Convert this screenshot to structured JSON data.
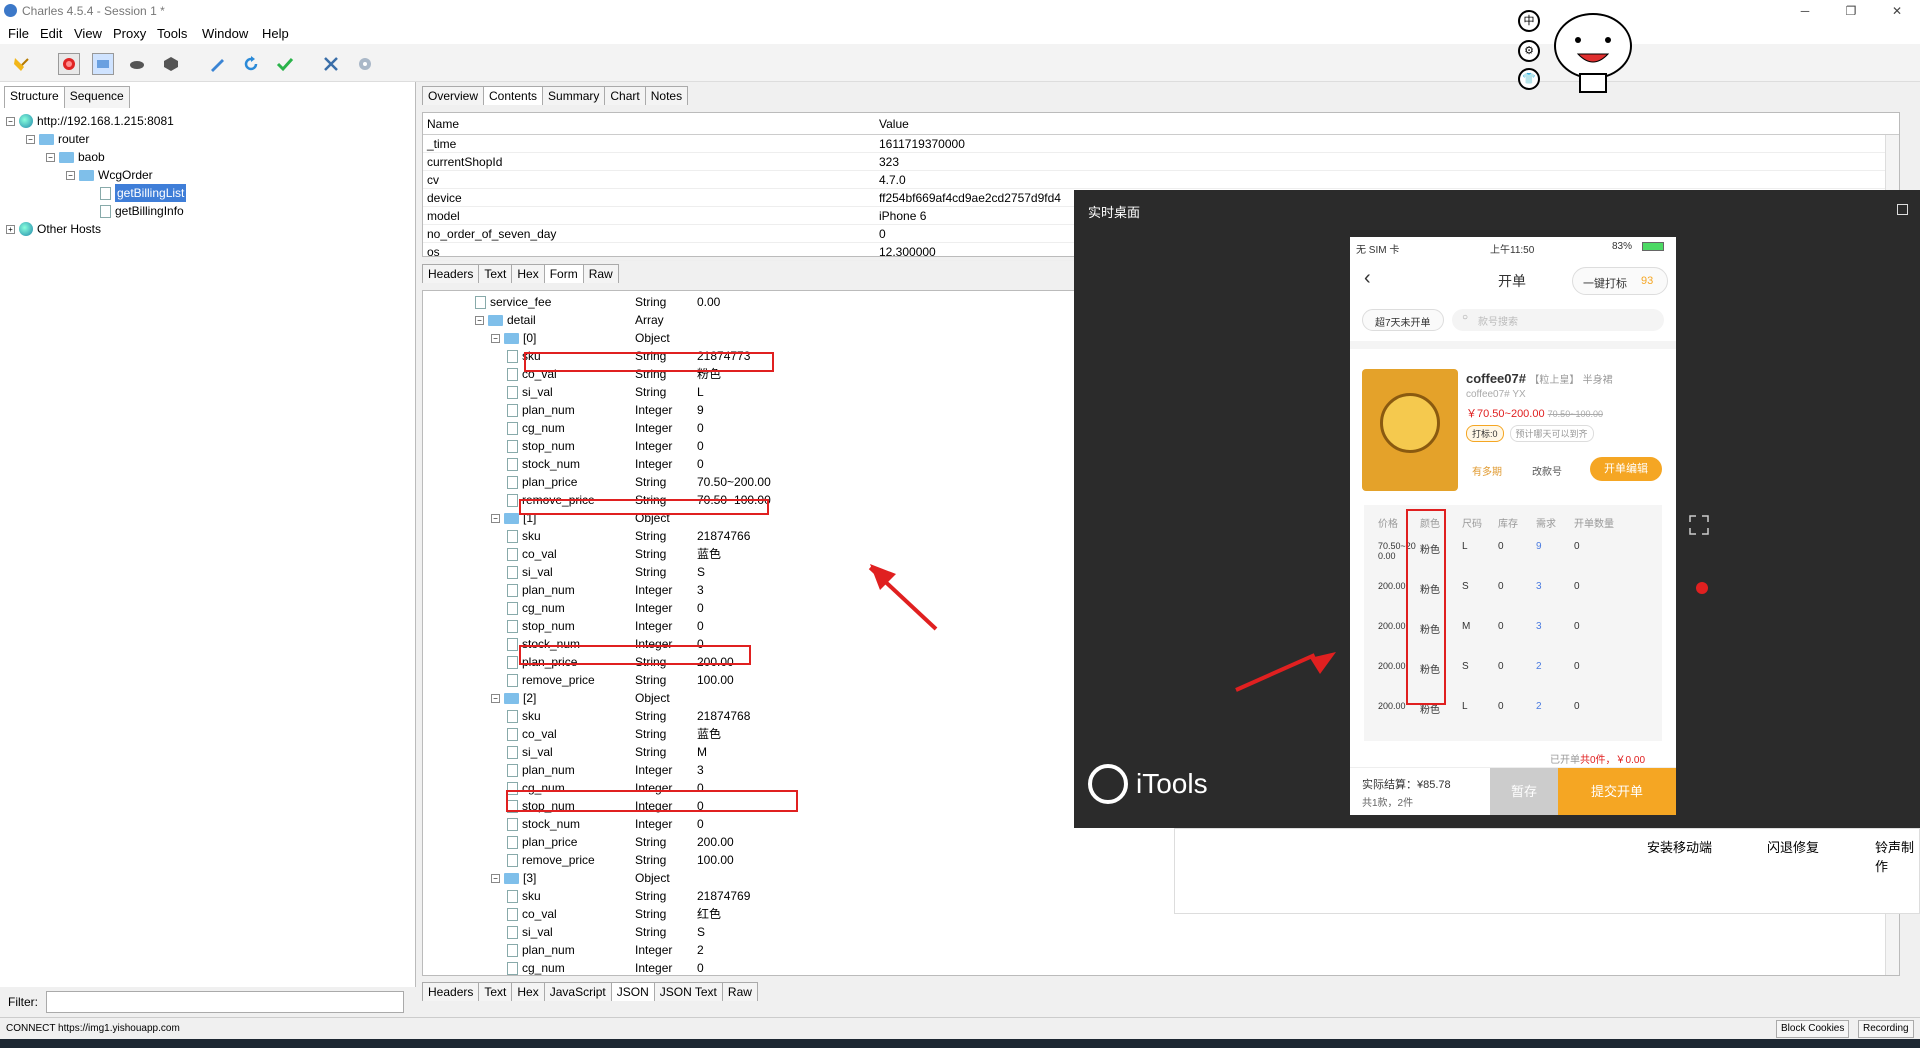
{
  "window": {
    "title": "Charles 4.5.4 - Session 1 *"
  },
  "menu": [
    "File",
    "Edit",
    "View",
    "Proxy",
    "Tools",
    "Window",
    "Help"
  ],
  "left": {
    "tabs": [
      "Structure",
      "Sequence"
    ],
    "tree": {
      "root": "http://192.168.1.215:8081",
      "router": "router",
      "baob": "baob",
      "wcg": "WcgOrder",
      "item1": "getBillingList",
      "item2": "getBillingInfo",
      "other": "Other Hosts"
    },
    "filter_label": "Filter:"
  },
  "right": {
    "tabs": [
      "Overview",
      "Contents",
      "Summary",
      "Chart",
      "Notes"
    ],
    "table": {
      "headers": [
        "Name",
        "Value"
      ],
      "rows": [
        {
          "name": "_time",
          "value": "1611719370000"
        },
        {
          "name": "currentShopId",
          "value": "323"
        },
        {
          "name": "cv",
          "value": "4.7.0"
        },
        {
          "name": "device",
          "value": "ff254bf669af4cd9ae2cd2757d9fd4"
        },
        {
          "name": "model",
          "value": "iPhone 6"
        },
        {
          "name": "no_order_of_seven_day",
          "value": "0"
        },
        {
          "name": "os",
          "value": "12.300000"
        }
      ]
    },
    "subtabs_req": [
      "Headers",
      "Text",
      "Hex",
      "Form",
      "Raw"
    ],
    "subtabs_resp": [
      "Headers",
      "Text",
      "Hex",
      "JavaScript",
      "JSON",
      "JSON Text",
      "Raw"
    ],
    "json_rows": [
      {
        "name": "service_fee",
        "type": "String",
        "value": "0.00",
        "level": 3,
        "leaf": true
      },
      {
        "name": "detail",
        "type": "Array",
        "value": "",
        "level": 3,
        "leaf": false
      },
      {
        "name": "[0]",
        "type": "Object",
        "value": "",
        "level": 4,
        "leaf": false
      },
      {
        "name": "sku",
        "type": "String",
        "value": "21874773",
        "level": 5,
        "leaf": true
      },
      {
        "name": "co_val",
        "type": "String",
        "value": "粉色",
        "level": 5,
        "leaf": true
      },
      {
        "name": "si_val",
        "type": "String",
        "value": "L",
        "level": 5,
        "leaf": true
      },
      {
        "name": "plan_num",
        "type": "Integer",
        "value": "9",
        "level": 5,
        "leaf": true
      },
      {
        "name": "cg_num",
        "type": "Integer",
        "value": "0",
        "level": 5,
        "leaf": true
      },
      {
        "name": "stop_num",
        "type": "Integer",
        "value": "0",
        "level": 5,
        "leaf": true
      },
      {
        "name": "stock_num",
        "type": "Integer",
        "value": "0",
        "level": 5,
        "leaf": true
      },
      {
        "name": "plan_price",
        "type": "String",
        "value": "70.50~200.00",
        "level": 5,
        "leaf": true
      },
      {
        "name": "remove_price",
        "type": "String",
        "value": "70.50~100.00",
        "level": 5,
        "leaf": true
      },
      {
        "name": "[1]",
        "type": "Object",
        "value": "",
        "level": 4,
        "leaf": false
      },
      {
        "name": "sku",
        "type": "String",
        "value": "21874766",
        "level": 5,
        "leaf": true
      },
      {
        "name": "co_val",
        "type": "String",
        "value": "蓝色",
        "level": 5,
        "leaf": true
      },
      {
        "name": "si_val",
        "type": "String",
        "value": "S",
        "level": 5,
        "leaf": true
      },
      {
        "name": "plan_num",
        "type": "Integer",
        "value": "3",
        "level": 5,
        "leaf": true
      },
      {
        "name": "cg_num",
        "type": "Integer",
        "value": "0",
        "level": 5,
        "leaf": true
      },
      {
        "name": "stop_num",
        "type": "Integer",
        "value": "0",
        "level": 5,
        "leaf": true
      },
      {
        "name": "stock_num",
        "type": "Integer",
        "value": "0",
        "level": 5,
        "leaf": true
      },
      {
        "name": "plan_price",
        "type": "String",
        "value": "200.00",
        "level": 5,
        "leaf": true
      },
      {
        "name": "remove_price",
        "type": "String",
        "value": "100.00",
        "level": 5,
        "leaf": true
      },
      {
        "name": "[2]",
        "type": "Object",
        "value": "",
        "level": 4,
        "leaf": false
      },
      {
        "name": "sku",
        "type": "String",
        "value": "21874768",
        "level": 5,
        "leaf": true
      },
      {
        "name": "co_val",
        "type": "String",
        "value": "蓝色",
        "level": 5,
        "leaf": true
      },
      {
        "name": "si_val",
        "type": "String",
        "value": "M",
        "level": 5,
        "leaf": true
      },
      {
        "name": "plan_num",
        "type": "Integer",
        "value": "3",
        "level": 5,
        "leaf": true
      },
      {
        "name": "cg_num",
        "type": "Integer",
        "value": "0",
        "level": 5,
        "leaf": true
      },
      {
        "name": "stop_num",
        "type": "Integer",
        "value": "0",
        "level": 5,
        "leaf": true
      },
      {
        "name": "stock_num",
        "type": "Integer",
        "value": "0",
        "level": 5,
        "leaf": true
      },
      {
        "name": "plan_price",
        "type": "String",
        "value": "200.00",
        "level": 5,
        "leaf": true
      },
      {
        "name": "remove_price",
        "type": "String",
        "value": "100.00",
        "level": 5,
        "leaf": true
      },
      {
        "name": "[3]",
        "type": "Object",
        "value": "",
        "level": 4,
        "leaf": false
      },
      {
        "name": "sku",
        "type": "String",
        "value": "21874769",
        "level": 5,
        "leaf": true
      },
      {
        "name": "co_val",
        "type": "String",
        "value": "红色",
        "level": 5,
        "leaf": true
      },
      {
        "name": "si_val",
        "type": "String",
        "value": "S",
        "level": 5,
        "leaf": true
      },
      {
        "name": "plan_num",
        "type": "Integer",
        "value": "2",
        "level": 5,
        "leaf": true
      },
      {
        "name": "cg_num",
        "type": "Integer",
        "value": "0",
        "level": 5,
        "leaf": true
      }
    ]
  },
  "status": {
    "text": "CONNECT https://img1.yishouapp.com",
    "block_cookies": "Block Cookies",
    "recording": "Recording"
  },
  "overlay": {
    "title": "实时桌面",
    "brand": "iTools"
  },
  "phone": {
    "carrier": "无 SIM 卡",
    "time": "上午11:50",
    "battery": "83%",
    "title": "开单",
    "one_key": "一键打标",
    "one_key_count": "93",
    "filter_chip": "超7天未开单",
    "search_placeholder": "款号搜索",
    "product_name": "coffee07#",
    "product_tag": "【粒上皇】",
    "product_cat": "半身裙",
    "product_sub": "coffee07#  YX",
    "price": "￥70.50~200.00",
    "old_price": "70.50~100.00",
    "mark": "打标:0",
    "tip": "预计哪天可以到齐",
    "opt1": "有多期",
    "opt2": "改款号",
    "edit_btn": "开单编辑",
    "grid_headers": [
      "价格",
      "颜色",
      "尺码",
      "库存",
      "需求",
      "开单数量"
    ],
    "grid_rows": [
      {
        "price": "70.50~200.00",
        "color": "粉色",
        "size": "L",
        "stock": "0",
        "need": "9",
        "qty": "0"
      },
      {
        "price": "200.00",
        "color": "粉色",
        "size": "S",
        "stock": "0",
        "need": "3",
        "qty": "0"
      },
      {
        "price": "200.00",
        "color": "粉色",
        "size": "M",
        "stock": "0",
        "need": "3",
        "qty": "0"
      },
      {
        "price": "200.00",
        "color": "粉色",
        "size": "S",
        "stock": "0",
        "need": "2",
        "qty": "0"
      },
      {
        "price": "200.00",
        "color": "粉色",
        "size": "L",
        "stock": "0",
        "need": "2",
        "qty": "0"
      }
    ],
    "summary_pre": "已开单",
    "summary": "共0件，￥0.00",
    "actual": "实际结算：¥85.78",
    "count": "共1款，2件",
    "save_btn": "暂存",
    "submit_btn": "提交开单"
  },
  "bg_links": [
    "安装移动端",
    "闪退修复",
    "铃声制作"
  ],
  "deco_glyphs": [
    "中",
    "⚙",
    "👕"
  ]
}
